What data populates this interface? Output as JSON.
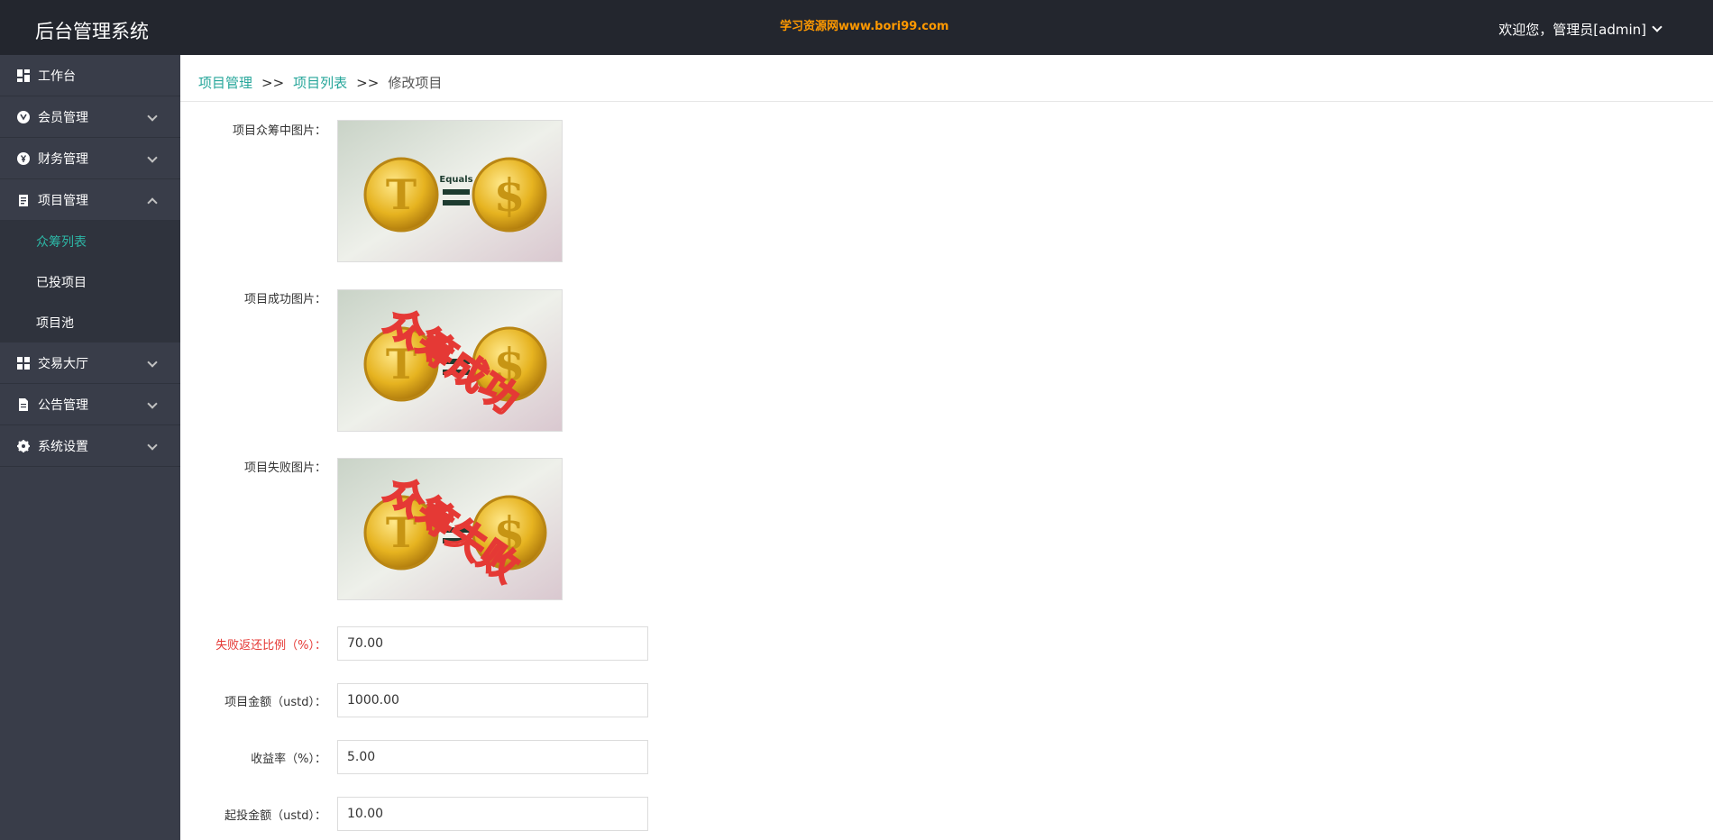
{
  "header": {
    "app_title": "后台管理系统",
    "watermark": "学习资源网www.bori99.com",
    "user_label": "欢迎您，管理员[admin]"
  },
  "sidebar": {
    "items": [
      {
        "label": "工作台",
        "icon": "dashboard-icon"
      },
      {
        "label": "会员管理",
        "icon": "member-icon"
      },
      {
        "label": "财务管理",
        "icon": "yen-icon"
      },
      {
        "label": "项目管理",
        "icon": "clipboard-icon"
      },
      {
        "label": "交易大厅",
        "icon": "trade-grid-icon"
      },
      {
        "label": "公告管理",
        "icon": "document-icon"
      },
      {
        "label": "系统设置",
        "icon": "gear-icon"
      }
    ],
    "subitems": [
      {
        "label": "众筹列表",
        "active": true
      },
      {
        "label": "已投项目",
        "active": false
      },
      {
        "label": "项目池",
        "active": false
      }
    ]
  },
  "breadcrumb": {
    "level1": "项目管理",
    "level2": "项目列表",
    "current": "修改项目",
    "separator": ">>"
  },
  "form": {
    "img_crowdfunding_label": "项目众筹中图片：",
    "img_success_label": "项目成功图片：",
    "img_fail_label": "项目失败图片：",
    "img_success_overlay": "众筹成功",
    "img_fail_overlay": "众筹失败",
    "img_equals_text": "Equals",
    "refund_ratio_label": "失败返还比例（%）：",
    "refund_ratio_value": "70.00",
    "amount_label": "项目金额（ustd）：",
    "amount_value": "1000.00",
    "yield_label": "收益率（%）：",
    "yield_value": "5.00",
    "min_invest_label": "起投金额（ustd）：",
    "min_invest_value": "10.00"
  },
  "colors": {
    "topbar": "#23262e",
    "sidebar": "#393d49",
    "accent": "#26a69a",
    "watermark": "#ff9900",
    "required": "#e53935"
  }
}
